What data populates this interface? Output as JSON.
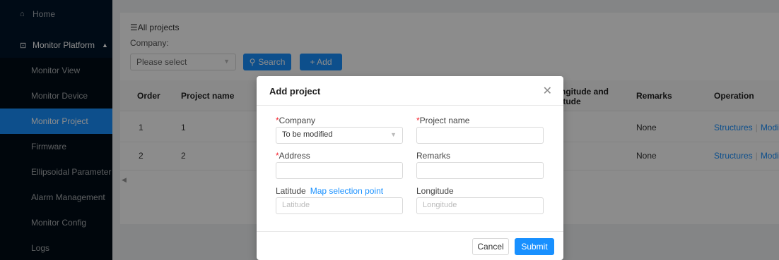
{
  "sidebar": {
    "home": "Home",
    "platform": "Monitor Platform",
    "items": [
      "Monitor View",
      "Monitor Device",
      "Monitor Project",
      "Firmware",
      "Ellipsoidal Parameter",
      "Alarm Management",
      "Monitor Config",
      "Logs"
    ],
    "active_item": "Monitor Project"
  },
  "main": {
    "breadcrumb": "All projects",
    "company_label": "Company:",
    "company_placeholder": "Please select",
    "search_label": "Search",
    "add_label": "+ Add",
    "columns": [
      "Order",
      "Project name",
      "ngitude and",
      "itude",
      "Remarks",
      "Operation"
    ],
    "rows": [
      {
        "order": "1",
        "name": "1",
        "remarks": "None",
        "op1": "Structures",
        "op2": "Modify"
      },
      {
        "order": "2",
        "name": "2",
        "remarks": "None",
        "op1": "Structures",
        "op2": "Modify"
      }
    ]
  },
  "modal": {
    "title": "Add project",
    "company_label": "Company",
    "company_value": "To be modified",
    "project_name_label": "Project name",
    "address_label": "Address",
    "remarks_label": "Remarks",
    "latitude_label": "Latitude",
    "map_link": "Map selection point",
    "latitude_placeholder": "Latitude",
    "longitude_label": "Longitude",
    "longitude_placeholder": "Longitude",
    "cancel_label": "Cancel",
    "submit_label": "Submit"
  },
  "colors": {
    "primary": "#1890ff",
    "sidebar": "#001529",
    "required": "#f5222d"
  }
}
